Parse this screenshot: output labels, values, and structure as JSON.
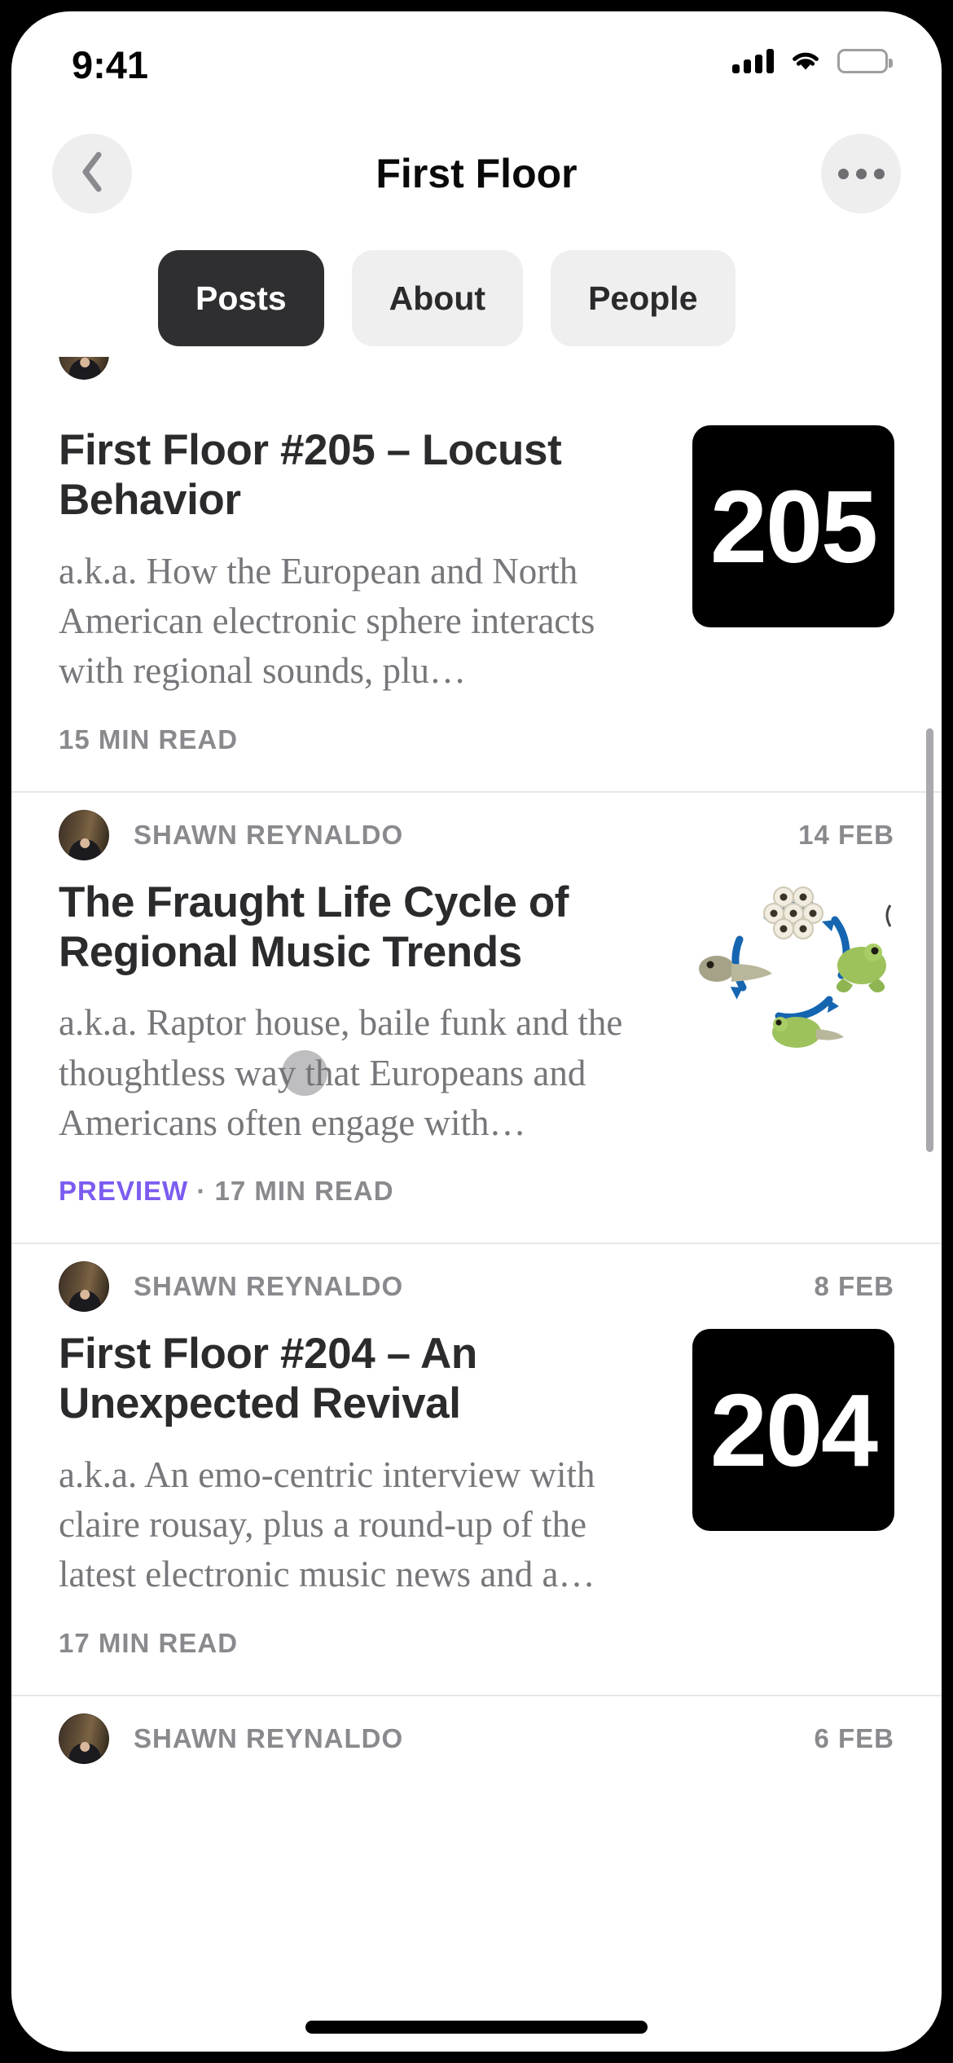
{
  "status_bar": {
    "time": "9:41",
    "icons": [
      "cellular-signal-icon",
      "wifi-icon",
      "battery-icon"
    ]
  },
  "nav": {
    "title": "First Floor",
    "back_icon": "chevron-left-icon",
    "more_icon": "ellipsis-icon"
  },
  "tabs": [
    {
      "label": "Posts",
      "active": true
    },
    {
      "label": "About",
      "active": false
    },
    {
      "label": "People",
      "active": false
    }
  ],
  "colors": {
    "accent_preview": "#7c5cf0",
    "tab_active_bg": "#2f2f31",
    "tab_inactive_bg": "#efeff0",
    "title_text": "#2b2b2d",
    "muted_text": "#8a8a8e",
    "body_text": "#77777b",
    "thumb_bg": "#000000"
  },
  "posts": [
    {
      "author": "",
      "date": "",
      "title": "First Floor #205 – Locust Behavior",
      "subtitle": "a.k.a. How the European and North American electronic sphere interacts with regional sounds, plu…",
      "preview_label": "",
      "read_time": "15 MIN READ",
      "thumb_type": "number",
      "thumb_label": "205",
      "clipped_top": true
    },
    {
      "author": "Shawn Reynaldo",
      "date": "14 Feb",
      "title": "The Fraught Life Cycle of Regional Music Trends",
      "subtitle": "a.k.a. Raptor house, baile funk and the thoughtless way that Europeans and Americans often engage with…",
      "preview_label": "PREVIEW",
      "read_time": "17 MIN READ",
      "thumb_type": "diagram",
      "thumb_label": "frog-life-cycle-diagram",
      "clipped_top": false
    },
    {
      "author": "Shawn Reynaldo",
      "date": "8 Feb",
      "title": "First Floor #204 – An Unexpected Revival",
      "subtitle": "a.k.a. An emo-centric interview with claire rousay, plus a round-up of the latest electronic music news and a…",
      "preview_label": "",
      "read_time": "17 MIN READ",
      "thumb_type": "number",
      "thumb_label": "204",
      "clipped_top": false
    },
    {
      "author": "Shawn Reynaldo",
      "date": "6 Feb",
      "title": "",
      "subtitle": "",
      "preview_label": "",
      "read_time": "",
      "thumb_type": "none",
      "thumb_label": "",
      "clipped_top": false
    }
  ],
  "separator_dot": "·"
}
